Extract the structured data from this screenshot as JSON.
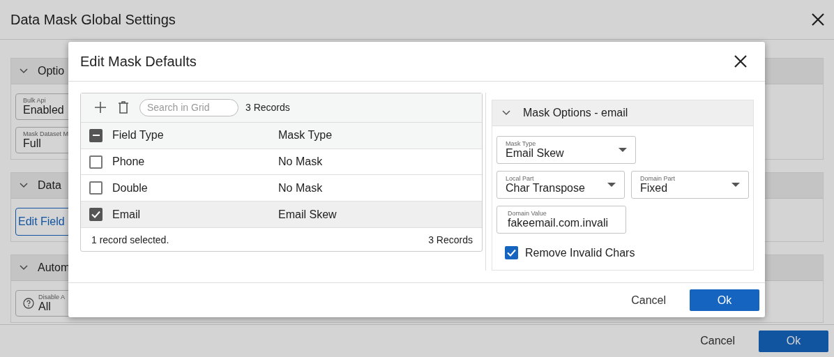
{
  "window": {
    "title": "Data Mask Global Settings"
  },
  "sections": [
    {
      "title": "Optio",
      "items": [
        {
          "kind": "field",
          "label": "Bulk Api",
          "value": "Enabled"
        },
        {
          "kind": "field",
          "label": "Mask Dataset M",
          "value": "Full"
        }
      ]
    },
    {
      "title": "Data",
      "items": [
        {
          "kind": "button",
          "label": "Edit Field"
        }
      ]
    },
    {
      "title": "Autom",
      "items": [
        {
          "kind": "help-field",
          "label": "Disable A",
          "value": "All"
        }
      ]
    }
  ],
  "footer_buttons": [
    {
      "label": "Cancel",
      "kind": "text"
    },
    {
      "label": "Ok",
      "kind": "primary"
    }
  ],
  "modal": {
    "title": "Edit Mask Defaults",
    "grid": {
      "search_placeholder": "Search in Grid",
      "record_count": "3 Records",
      "some_selected": true,
      "columns": [
        "Field Type",
        "Mask Type"
      ],
      "rows": [
        {
          "field_type": "Phone",
          "mask_type": "No Mask",
          "selected": false
        },
        {
          "field_type": "Double",
          "mask_type": "No Mask",
          "selected": false
        },
        {
          "field_type": "Email",
          "mask_type": "Email Skew",
          "selected": true
        }
      ],
      "status": "1 record selected.",
      "footer_count": "3 Records"
    },
    "options": {
      "title": "Mask Options - email",
      "rows": [
        [
          {
            "kind": "select",
            "label": "Mask Type",
            "value": "Email Skew"
          }
        ],
        [
          {
            "kind": "select",
            "label": "Local Part",
            "value": "Char Transpose"
          },
          {
            "kind": "select",
            "label": "Domain Part",
            "value": "Fixed"
          }
        ],
        [
          {
            "kind": "input",
            "label": "Domain Value",
            "value": "fakeemail.com.invali"
          }
        ]
      ],
      "checkbox": {
        "label": "Remove Invalid Chars",
        "checked": true
      }
    },
    "buttons": [
      {
        "label": "Cancel",
        "kind": "text"
      },
      {
        "label": "Ok",
        "kind": "primary"
      }
    ]
  }
}
